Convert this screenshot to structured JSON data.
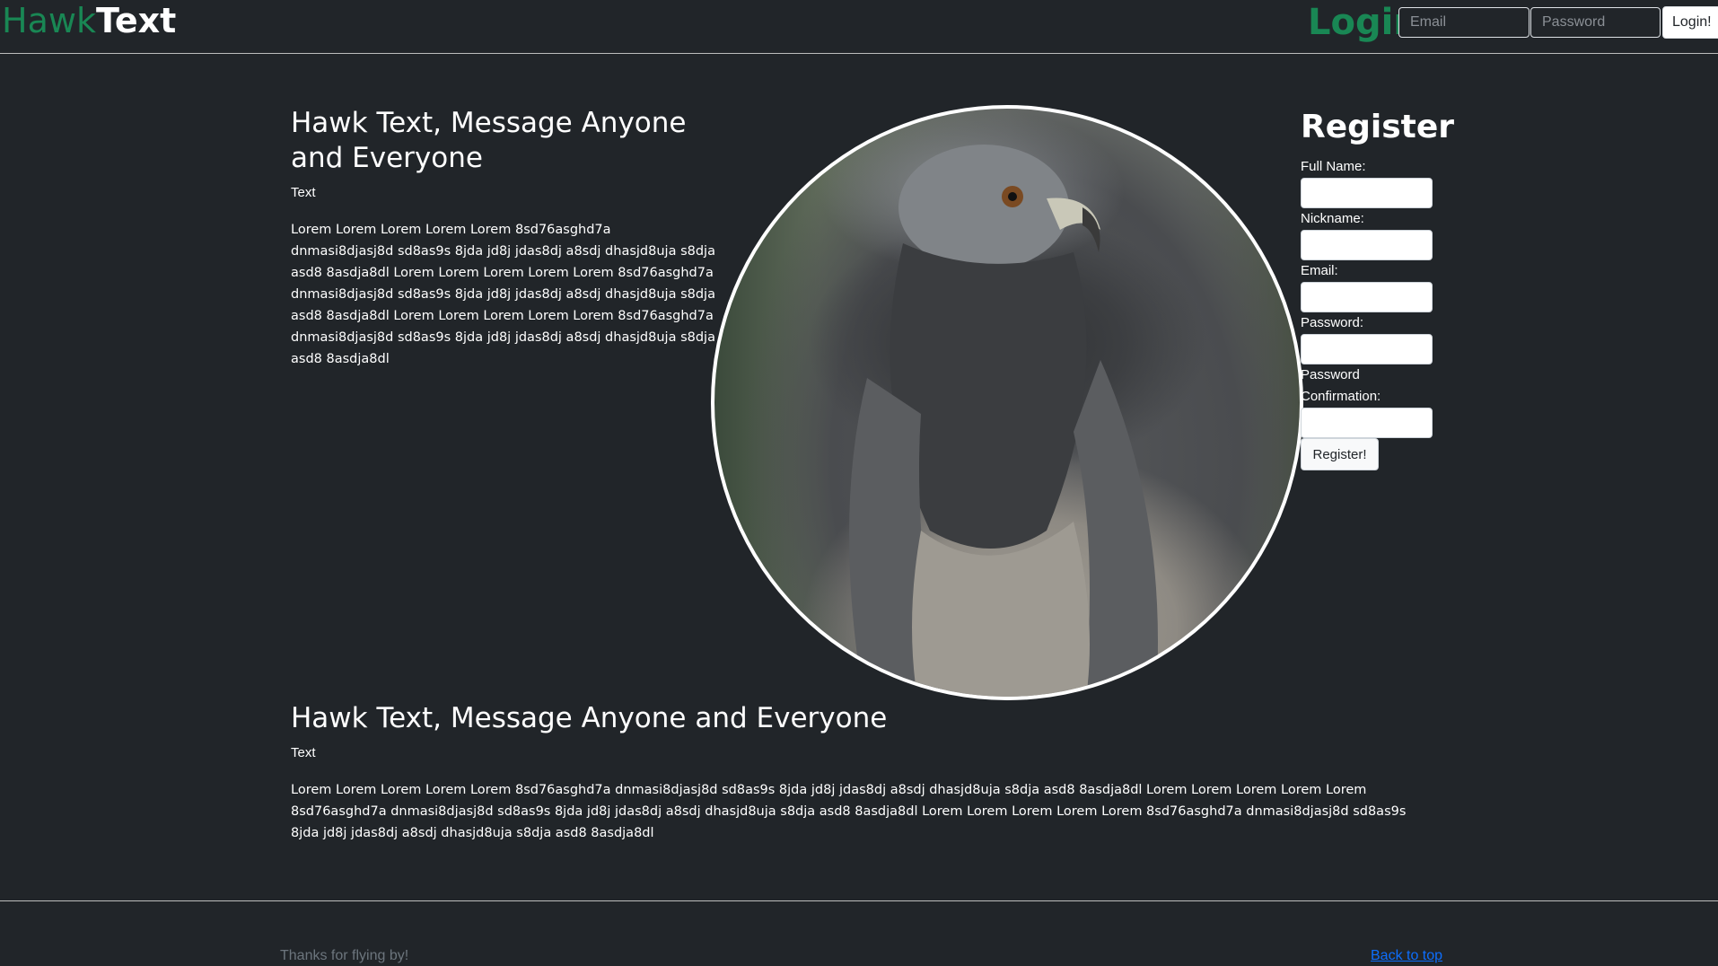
{
  "navbar": {
    "brand_part1": "Hawk",
    "brand_part2": "Text",
    "login_title": "Login",
    "email_placeholder": "Email",
    "password_placeholder": "Password",
    "login_button": "Login!"
  },
  "hero": {
    "title": "Hawk Text, Message Anyone and Everyone",
    "label": "Text",
    "paragraph": "Lorem Lorem Lorem Lorem Lorem 8sd76asghd7a dnmasi8djasj8d sd8as9s 8jda jd8j jdas8dj a8sdj dhasjd8uja s8dja asd8 8asdja8dl Lorem Lorem Lorem Lorem Lorem 8sd76asghd7a dnmasi8djasj8d sd8as9s 8jda jd8j jdas8dj a8sdj dhasjd8uja s8dja asd8 8asdja8dl Lorem Lorem Lorem Lorem Lorem 8sd76asghd7a dnmasi8djasj8d sd8as9s 8jda jd8j jdas8dj a8sdj dhasjd8uja s8dja asd8 8asdja8dl"
  },
  "image": {
    "alt": "Eagle photo"
  },
  "register": {
    "title": "Register",
    "full_name_label": "Full Name:",
    "nickname_label": "Nickname:",
    "email_label": "Email:",
    "password_label": "Password:",
    "password_confirmation_label": "Password Confirmation:",
    "submit_label": "Register!"
  },
  "section2": {
    "title": "Hawk Text, Message Anyone and Everyone",
    "label": "Text",
    "paragraph": "Lorem Lorem Lorem Lorem Lorem 8sd76asghd7a dnmasi8djasj8d sd8as9s 8jda jd8j jdas8dj a8sdj dhasjd8uja s8dja asd8 8asdja8dl Lorem Lorem Lorem Lorem Lorem 8sd76asghd7a dnmasi8djasj8d sd8as9s 8jda jd8j jdas8dj a8sdj dhasjd8uja s8dja asd8 8asdja8dl Lorem Lorem Lorem Lorem Lorem 8sd76asghd7a dnmasi8djasj8d sd8as9s 8jda jd8j jdas8dj a8sdj dhasjd8uja s8dja asd8 8asdja8dl"
  },
  "footer": {
    "tagline": "Thanks for flying by!",
    "back_to_top": "Back to top"
  },
  "colors": {
    "background": "#212529",
    "brand_green": "#198754",
    "link_blue": "#0d6efd"
  }
}
